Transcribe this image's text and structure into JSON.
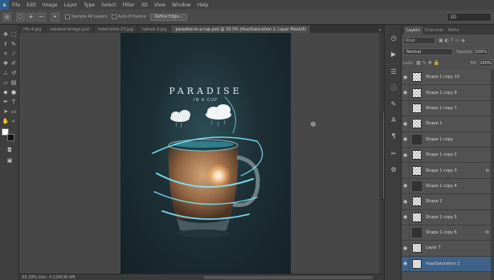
{
  "app": {
    "logo": "s"
  },
  "menu": [
    "File",
    "Edit",
    "Image",
    "Layer",
    "Type",
    "Select",
    "Filter",
    "3D",
    "View",
    "Window",
    "Help"
  ],
  "options": {
    "sample_all_layers": "Sample All Layers",
    "auto_enhance": "Auto-Enhance",
    "refine_edge": "Refine Edge...",
    "workspace": "3D"
  },
  "tabs": [
    {
      "label": "rfly-4.jpg",
      "active": false
    },
    {
      "label": "rainbow-bridge.psd",
      "active": false
    },
    {
      "label": "hotel-blink-15.jpg",
      "active": false
    },
    {
      "label": "nature-3.jpg",
      "active": false
    },
    {
      "label": "paradise-in-a-cup.psd @ 33.3% (Hue/Saturation 2, Layer Mask/8)",
      "active": true
    }
  ],
  "document": {
    "title": "PARADISE",
    "subtitle": "IN A CUP"
  },
  "status": {
    "zoom": "33.33%",
    "doc_size": "Doc: 4.12M/36.9M"
  },
  "layers_panel": {
    "tabs": [
      "Layers",
      "Channels",
      "Paths"
    ],
    "kind": "Kind",
    "blend_mode": "Normal",
    "opacity_label": "Opacity:",
    "opacity": "100%",
    "lock_label": "Lock:",
    "fill_label": "Fill:",
    "fill": "100%",
    "layers": [
      {
        "name": "Shape 1 copy 10",
        "visible": true,
        "thumb": "checker",
        "fx": false,
        "selected": false
      },
      {
        "name": "Shape 1 copy 9",
        "visible": true,
        "thumb": "checker",
        "fx": false,
        "selected": false
      },
      {
        "name": "Shape 1 copy 7",
        "visible": false,
        "thumb": "checker",
        "fx": false,
        "selected": false
      },
      {
        "name": "Shape 1",
        "visible": true,
        "thumb": "checker",
        "fx": false,
        "selected": false
      },
      {
        "name": "Shape 1 copy",
        "visible": true,
        "thumb": "dark",
        "fx": false,
        "selected": false
      },
      {
        "name": "Shape 1 copy 2",
        "visible": true,
        "thumb": "checker",
        "fx": false,
        "selected": false
      },
      {
        "name": "Shape 1 copy 3",
        "visible": false,
        "thumb": "checker",
        "fx": true,
        "selected": false
      },
      {
        "name": "Shape 1 copy 4",
        "visible": true,
        "thumb": "dark",
        "fx": false,
        "selected": false
      },
      {
        "name": "Shape 2",
        "visible": true,
        "thumb": "checker",
        "fx": false,
        "selected": false
      },
      {
        "name": "Shape 1 copy 5",
        "visible": true,
        "thumb": "checker",
        "fx": false,
        "selected": false
      },
      {
        "name": "Shape 1 copy 6",
        "visible": false,
        "thumb": "dark",
        "fx": true,
        "selected": false
      },
      {
        "name": "Layer 7",
        "visible": true,
        "thumb": "checker",
        "fx": false,
        "selected": false
      },
      {
        "name": "Hue/Saturation 2",
        "visible": true,
        "thumb": "adj",
        "fx": false,
        "selected": true
      }
    ]
  },
  "colors": {
    "accent": "#3e6288",
    "glow": "#7fe9ff"
  }
}
